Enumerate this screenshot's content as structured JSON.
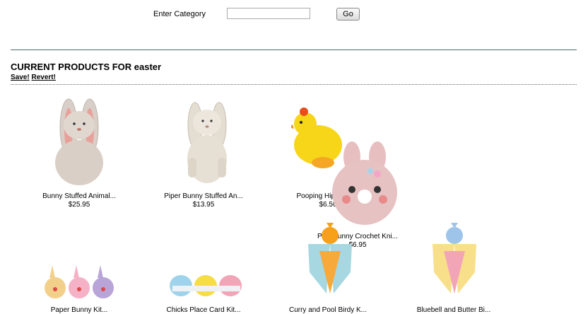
{
  "search": {
    "label": "Enter Category",
    "value": "",
    "button": "Go"
  },
  "section": {
    "title": "CURRENT PRODUCTS FOR easter",
    "save": "Save!",
    "revert": "Revert!"
  },
  "products": [
    {
      "name": "Bunny Stuffed Animal...",
      "price": "$25.95"
    },
    {
      "name": "Piper Bunny Stuffed An...",
      "price": "$13.95"
    },
    {
      "name": "Pooping Hippy Ch...",
      "price": "$6.50"
    },
    {
      "name": "Pink Bunny Crochet Kni...",
      "price": "$6.95"
    },
    {
      "name": "Paper Bunny Kit...",
      "price": ""
    },
    {
      "name": "Chicks Place Card Kit...",
      "price": ""
    },
    {
      "name": "Curry and Pool Birdy K...",
      "price": ""
    },
    {
      "name": "Bluebell and Butter Bi...",
      "price": ""
    }
  ]
}
